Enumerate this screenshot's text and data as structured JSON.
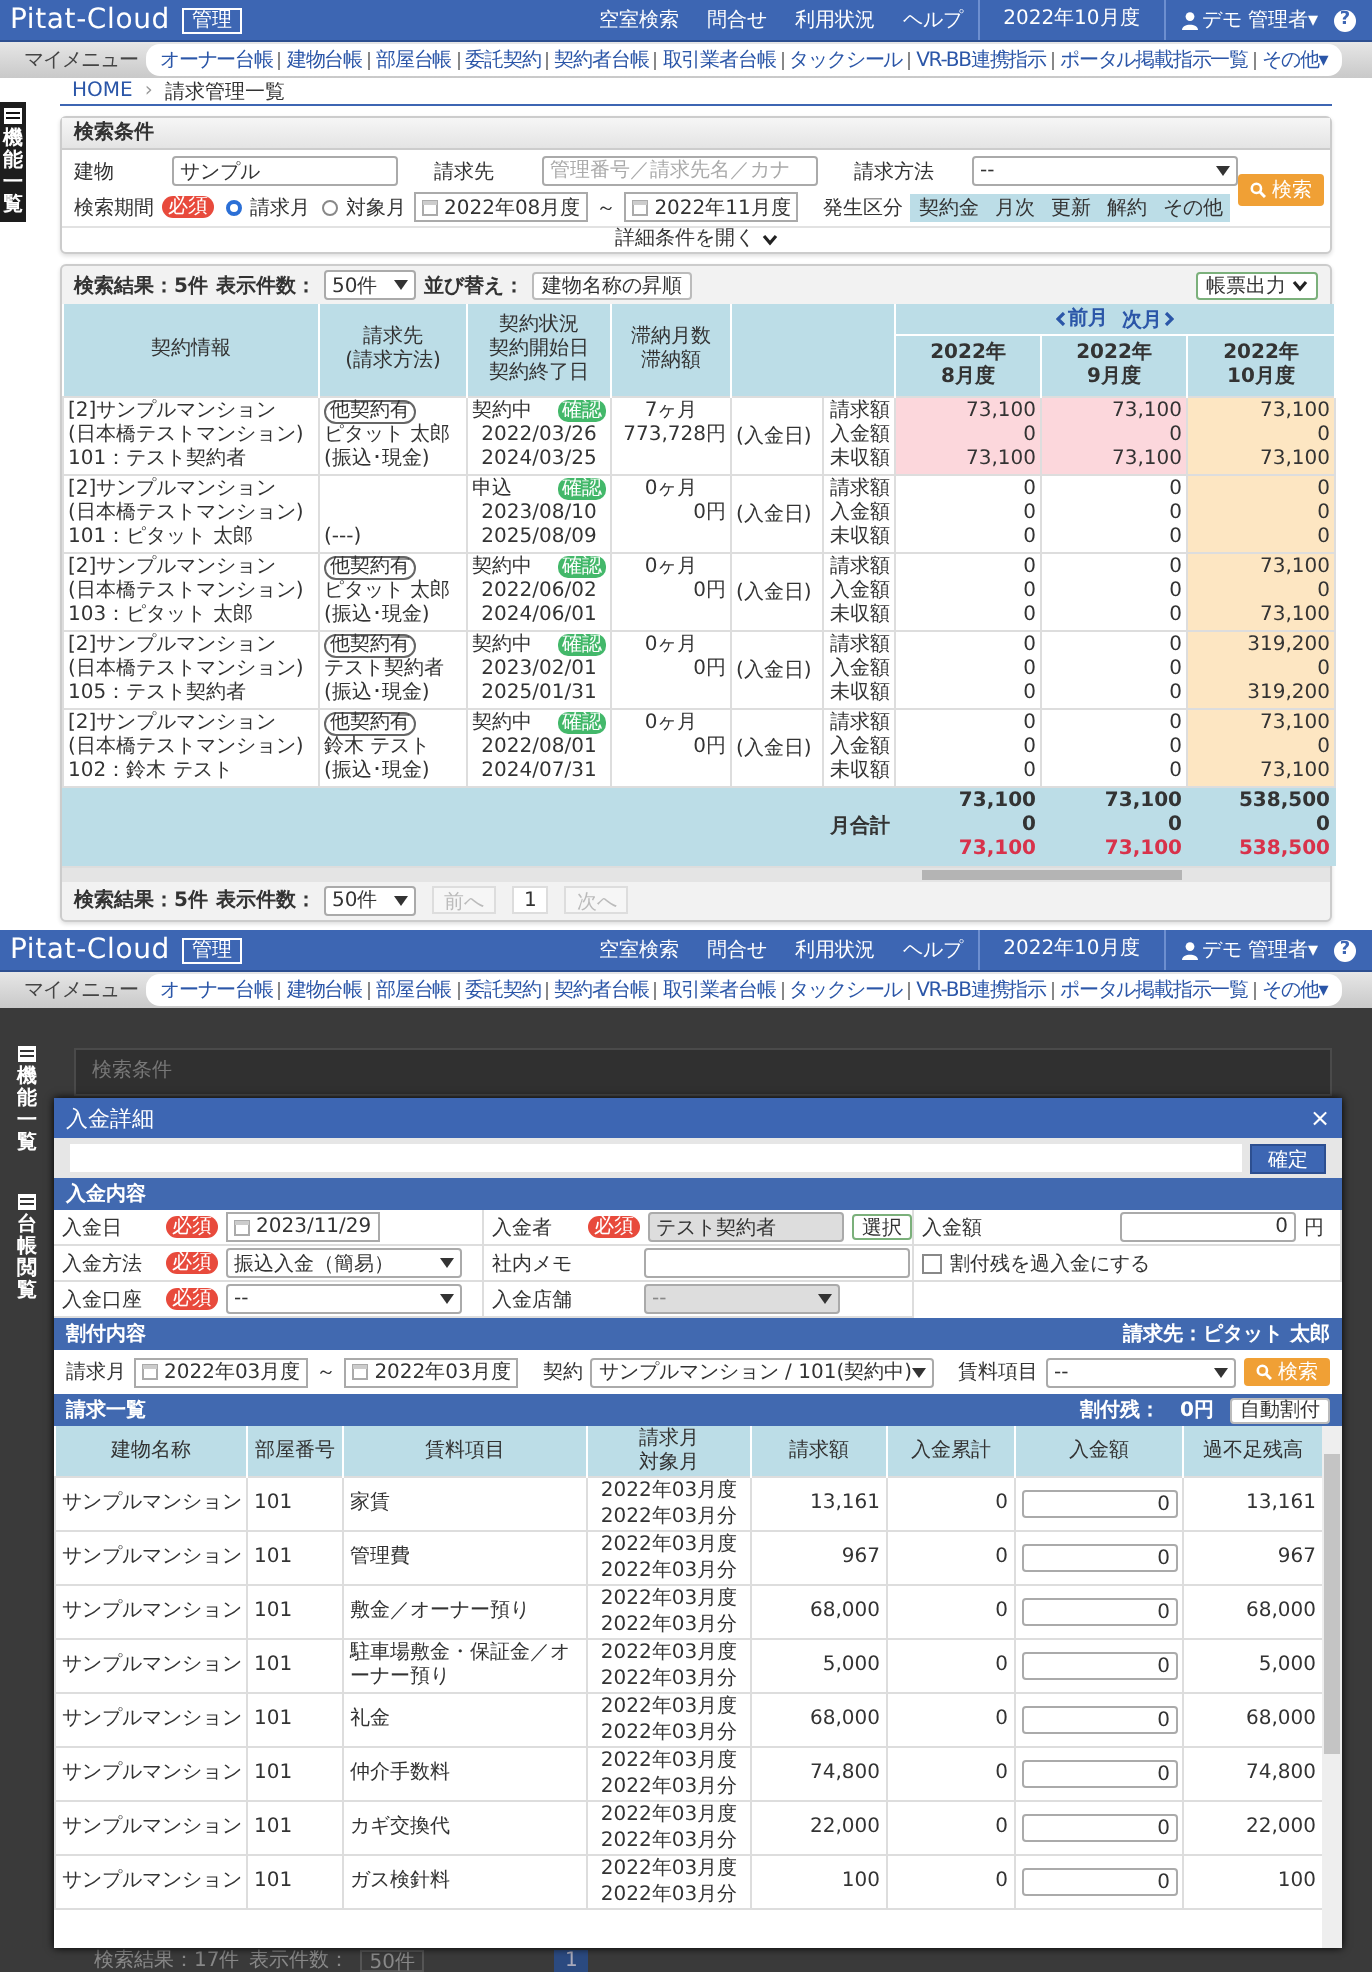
{
  "screen_1": {
    "header": {
      "logo": "Pitat-Cloud",
      "logo_badge": "管理",
      "links": [
        "空室検索",
        "問合せ",
        "利用状況",
        "ヘルプ"
      ],
      "period": "2022年10月度",
      "user": "デモ 管理者▾",
      "help": "?"
    },
    "menu": {
      "label": "マイメニュー",
      "items": [
        "オーナー台帳",
        "建物台帳",
        "部屋台帳",
        "委託契約",
        "契約者台帳",
        "取引業者台帳",
        "タックシール",
        "VR-BB連携指示",
        "ポータル掲載指示一覧",
        "その他▾"
      ]
    },
    "side_tabs": [
      "機能一覧"
    ],
    "breadcrumb": {
      "home": "HOME",
      "separator": "›",
      "current": "請求管理一覧"
    },
    "search": {
      "title": "検索条件",
      "building": {
        "label": "建物",
        "value": "サンプル"
      },
      "billing_to": {
        "label": "請求先",
        "placeholder": "管理番号／請求先名／カナ"
      },
      "billing_method": {
        "label": "請求方法",
        "value": "--"
      },
      "period": {
        "label": "検索期間",
        "required": "必須",
        "options": [
          {
            "label": "請求月",
            "selected": true
          },
          {
            "label": "対象月",
            "selected": false
          }
        ],
        "from": "2022年08月度",
        "separator": "～",
        "to": "2022年11月度"
      },
      "category": {
        "label": "発生区分",
        "chips": [
          {
            "label": "契約金",
            "selected": true
          },
          {
            "label": "月次",
            "selected": true
          },
          {
            "label": "更新",
            "selected": true
          },
          {
            "label": "解約",
            "selected": true
          },
          {
            "label": "その他",
            "selected": true
          }
        ]
      },
      "search_button": "検索",
      "expand": "詳細条件を開く"
    },
    "results": {
      "toolbar": {
        "count": "検索結果：5件",
        "per_page_label": "表示件数：",
        "per_page": "50件",
        "sort_label": "並び替え：",
        "sort": "建物名称の昇順",
        "export": "帳票出力"
      },
      "columns": [
        [
          "契約情報"
        ],
        [
          "請求先",
          "(請求方法)"
        ],
        [
          "契約状況",
          "契約開始日",
          "契約終了日"
        ],
        [
          "滞納月数",
          "滞納額"
        ]
      ],
      "month_nav": {
        "prev": "前月",
        "next": "次月"
      },
      "months": [
        {
          "year": "2022年",
          "month": "8月度",
          "current": false
        },
        {
          "year": "2022年",
          "month": "9月度",
          "current": false
        },
        {
          "year": "2022年",
          "month": "10月度",
          "current": true
        }
      ],
      "rows": [
        {
          "contract": [
            "[2]サンプルマンション",
            "(日本橋テストマンション)",
            "101：テスト契約者"
          ],
          "billing": {
            "badge": "他契約有",
            "name": "ピタット 太郎",
            "method": "(振込･現金)"
          },
          "status": "契約中",
          "status_badge": "確認",
          "start": "2022/03/26",
          "end": "2024/03/25",
          "overdue_months": "7ヶ月",
          "overdue_amount": "773,728円",
          "paid_date": "(入金日)",
          "labels": [
            "請求額",
            "入金額",
            "未収額"
          ],
          "months": [
            {
              "values": [
                "73,100",
                "0",
                "73,100"
              ],
              "overdue": true
            },
            {
              "values": [
                "73,100",
                "0",
                "73,100"
              ],
              "overdue": true
            },
            {
              "values": [
                "73,100",
                "0",
                "73,100"
              ],
              "overdue": false
            }
          ]
        },
        {
          "contract": [
            "[2]サンプルマンション",
            "(日本橋テストマンション)",
            "101：ピタット 太郎"
          ],
          "billing": {
            "method": "(---)"
          },
          "status": "申込",
          "status_badge": "確認",
          "start": "2023/08/10",
          "end": "2025/08/09",
          "overdue_months": "0ヶ月",
          "overdue_amount": "0円",
          "paid_date": "(入金日)",
          "labels": [
            "請求額",
            "入金額",
            "未収額"
          ],
          "months": [
            {
              "values": [
                "0",
                "0",
                "0"
              ],
              "overdue": false
            },
            {
              "values": [
                "0",
                "0",
                "0"
              ],
              "overdue": false
            },
            {
              "values": [
                "0",
                "0",
                "0"
              ],
              "overdue": false
            }
          ]
        },
        {
          "contract": [
            "[2]サンプルマンション",
            "(日本橋テストマンション)",
            "103：ピタット 太郎"
          ],
          "billing": {
            "badge": "他契約有",
            "name": "ピタット 太郎",
            "method": "(振込･現金)"
          },
          "status": "契約中",
          "status_badge": "確認",
          "start": "2022/06/02",
          "end": "2024/06/01",
          "overdue_months": "0ヶ月",
          "overdue_amount": "0円",
          "paid_date": "(入金日)",
          "labels": [
            "請求額",
            "入金額",
            "未収額"
          ],
          "months": [
            {
              "values": [
                "0",
                "0",
                "0"
              ],
              "overdue": false
            },
            {
              "values": [
                "0",
                "0",
                "0"
              ],
              "overdue": false
            },
            {
              "values": [
                "73,100",
                "0",
                "73,100"
              ],
              "overdue": false
            }
          ]
        },
        {
          "contract": [
            "[2]サンプルマンション",
            "(日本橋テストマンション)",
            "105：テスト契約者"
          ],
          "billing": {
            "badge": "他契約有",
            "name": "テスト契約者",
            "method": "(振込･現金)"
          },
          "status": "契約中",
          "status_badge": "確認",
          "start": "2023/02/01",
          "end": "2025/01/31",
          "overdue_months": "0ヶ月",
          "overdue_amount": "0円",
          "paid_date": "(入金日)",
          "labels": [
            "請求額",
            "入金額",
            "未収額"
          ],
          "months": [
            {
              "values": [
                "0",
                "0",
                "0"
              ],
              "overdue": false
            },
            {
              "values": [
                "0",
                "0",
                "0"
              ],
              "overdue": false
            },
            {
              "values": [
                "319,200",
                "0",
                "319,200"
              ],
              "overdue": false
            }
          ]
        },
        {
          "contract": [
            "[2]サンプルマンション",
            "(日本橋テストマンション)",
            "102：鈴木 テスト"
          ],
          "billing": {
            "badge": "他契約有",
            "name": "鈴木 テスト",
            "method": "(振込･現金)"
          },
          "status": "契約中",
          "status_badge": "確認",
          "start": "2022/08/01",
          "end": "2024/07/31",
          "overdue_months": "0ヶ月",
          "overdue_amount": "0円",
          "paid_date": "(入金日)",
          "labels": [
            "請求額",
            "入金額",
            "未収額"
          ],
          "months": [
            {
              "values": [
                "0",
                "0",
                "0"
              ],
              "overdue": false
            },
            {
              "values": [
                "0",
                "0",
                "0"
              ],
              "overdue": false
            },
            {
              "values": [
                "73,100",
                "0",
                "73,100"
              ],
              "overdue": false
            }
          ]
        }
      ],
      "totals": {
        "label": "月合計",
        "months": [
          [
            "73,100",
            "0",
            "73,100"
          ],
          [
            "73,100",
            "0",
            "73,100"
          ],
          [
            "538,500",
            "0",
            "538,500"
          ]
        ]
      },
      "footer": {
        "count": "検索結果：5件",
        "per_page_label": "表示件数：",
        "per_page": "50件",
        "prev": {
          "label": "前へ",
          "disabled": true
        },
        "page": "1",
        "next": {
          "label": "次へ",
          "disabled": true
        }
      }
    }
  },
  "screen_2": {
    "header": {
      "logo": "Pitat-Cloud",
      "logo_badge": "管理",
      "links": [
        "空室検索",
        "問合せ",
        "利用状況",
        "ヘルプ"
      ],
      "period": "2022年10月度",
      "user": "デモ 管理者▾",
      "help": "?"
    },
    "menu": {
      "label": "マイメニュー",
      "items": [
        "オーナー台帳",
        "建物台帳",
        "部屋台帳",
        "委託契約",
        "契約者台帳",
        "取引業者台帳",
        "タックシール",
        "VR-BB連携指示",
        "ポータル掲載指示一覧",
        "その他▾"
      ]
    },
    "side_tabs": [
      "機能一覧",
      "台帳閲覧"
    ],
    "backdrop": {
      "panel_title": "検索条件",
      "count": "検索結果：17件",
      "per_page_label": "表示件数：",
      "per_page": "50件",
      "page": "1"
    },
    "modal": {
      "title": "入金詳細",
      "close": "×",
      "confirm": "確定",
      "payment": {
        "title": "入金内容",
        "date": {
          "label": "入金日",
          "required": "必須",
          "value": "2023/11/29"
        },
        "payer": {
          "label": "入金者",
          "required": "必須",
          "value": "テスト契約者",
          "select": "選択"
        },
        "amount": {
          "label": "入金額",
          "value": "0",
          "unit": "円"
        },
        "method": {
          "label": "入金方法",
          "required": "必須",
          "value": "振込入金（簡易）"
        },
        "memo": {
          "label": "社内メモ"
        },
        "overpay": {
          "label": "割付残を過入金にする",
          "checked": false
        },
        "account": {
          "label": "入金口座",
          "required": "必須",
          "value": "--"
        },
        "store": {
          "label": "入金店舗",
          "value": "--",
          "disabled": true
        }
      },
      "allocation": {
        "title": "割付内容",
        "billing_to": "請求先：ピタット 太郎",
        "month_label": "請求月",
        "from": "2022年03月度",
        "separator": "～",
        "to": "2022年03月度",
        "contract_label": "契約",
        "contract": "サンプルマンション / 101(契約中)",
        "item_label": "賃料項目",
        "item": "--",
        "search": "検索"
      },
      "billing_list": {
        "title": "請求一覧",
        "remaining": "割付残：　0円",
        "auto": "自動割付",
        "columns": [
          [
            "建物名称"
          ],
          [
            "部屋番号"
          ],
          [
            "賃料項目"
          ],
          [
            "請求月",
            "対象月"
          ],
          [
            "請求額"
          ],
          [
            "入金累計"
          ],
          [
            "入金額"
          ],
          [
            "過不足残高"
          ]
        ],
        "rows": [
          {
            "building": "サンプルマンション",
            "room": "101",
            "item": "家賃",
            "billing_month": "2022年03月度",
            "target_month": "2022年03月分",
            "amount": "13,161",
            "paid_total": "0",
            "payment": "0",
            "balance": "13,161"
          },
          {
            "building": "サンプルマンション",
            "room": "101",
            "item": "管理費",
            "billing_month": "2022年03月度",
            "target_month": "2022年03月分",
            "amount": "967",
            "paid_total": "0",
            "payment": "0",
            "balance": "967"
          },
          {
            "building": "サンプルマンション",
            "room": "101",
            "item": "敷金／オーナー預り",
            "billing_month": "2022年03月度",
            "target_month": "2022年03月分",
            "amount": "68,000",
            "paid_total": "0",
            "payment": "0",
            "balance": "68,000"
          },
          {
            "building": "サンプルマンション",
            "room": "101",
            "item": "駐車場敷金・保証金／オーナー預り",
            "billing_month": "2022年03月度",
            "target_month": "2022年03月分",
            "amount": "5,000",
            "paid_total": "0",
            "payment": "0",
            "balance": "5,000"
          },
          {
            "building": "サンプルマンション",
            "room": "101",
            "item": "礼金",
            "billing_month": "2022年03月度",
            "target_month": "2022年03月分",
            "amount": "68,000",
            "paid_total": "0",
            "payment": "0",
            "balance": "68,000"
          },
          {
            "building": "サンプルマンション",
            "room": "101",
            "item": "仲介手数料",
            "billing_month": "2022年03月度",
            "target_month": "2022年03月分",
            "amount": "74,800",
            "paid_total": "0",
            "payment": "0",
            "balance": "74,800"
          },
          {
            "building": "サンプルマンション",
            "room": "101",
            "item": "カギ交換代",
            "billing_month": "2022年03月度",
            "target_month": "2022年03月分",
            "amount": "22,000",
            "paid_total": "0",
            "payment": "0",
            "balance": "22,000"
          },
          {
            "building": "サンプルマンション",
            "room": "101",
            "item": "ガス検針料",
            "billing_month": "2022年03月度",
            "target_month": "2022年03月分",
            "amount": "100",
            "paid_total": "0",
            "payment": "0",
            "balance": "100"
          }
        ]
      }
    }
  }
}
